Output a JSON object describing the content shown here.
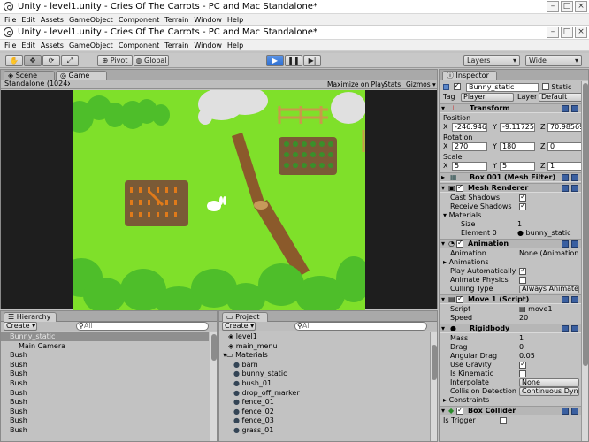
{
  "window1": {
    "title": "Unity - level1.unity - Cries Of The Carrots - PC and Mac Standalone*"
  },
  "window2": {
    "title": "Unity - level1.unity - Cries Of The Carrots - PC and Mac Standalone*"
  },
  "menu": [
    "File",
    "Edit",
    "Assets",
    "GameObject",
    "Component",
    "Terrain",
    "Window",
    "Help"
  ],
  "toolbar": {
    "pivot": "Pivot",
    "global": "Global",
    "layers": "Layers",
    "layout": "Wide"
  },
  "scene_tabs": {
    "scene": "Scene",
    "game": "Game"
  },
  "game_bar": {
    "resolution": "Standalone (1024x76",
    "maximize": "Maximize on Play",
    "stats": "Stats",
    "gizmos": "Gizmos"
  },
  "hierarchy": {
    "title": "Hierarchy",
    "create": "Create",
    "search": "All",
    "items": [
      "Bunny_static",
      "Main Camera",
      "Bush",
      "Bush",
      "Bush",
      "Bush",
      "Bush",
      "Bush",
      "Bush",
      "Bush",
      "Bush"
    ]
  },
  "project": {
    "title": "Project",
    "create": "Create",
    "search": "All",
    "items": [
      {
        "label": "level1",
        "type": "scene",
        "indent": 1
      },
      {
        "label": "main_menu",
        "type": "scene",
        "indent": 1
      },
      {
        "label": "Materials",
        "type": "folder",
        "indent": 0
      },
      {
        "label": "barn",
        "type": "material",
        "indent": 2
      },
      {
        "label": "bunny_static",
        "type": "material",
        "indent": 2
      },
      {
        "label": "bush_01",
        "type": "material",
        "indent": 2
      },
      {
        "label": "drop_off_marker",
        "type": "material",
        "indent": 2
      },
      {
        "label": "fence_01",
        "type": "material",
        "indent": 2
      },
      {
        "label": "fence_02",
        "type": "material",
        "indent": 2
      },
      {
        "label": "fence_03",
        "type": "material",
        "indent": 2
      },
      {
        "label": "grass_01",
        "type": "material",
        "indent": 2
      }
    ]
  },
  "inspector": {
    "tab": "Inspector",
    "name": "Bunny_static",
    "static": "Static",
    "tag_label": "Tag",
    "tag": "Player",
    "layer_label": "Layer",
    "layer": "Default",
    "transform": {
      "title": "Transform",
      "position": "Position",
      "rotation": "Rotation",
      "scale": "Scale",
      "pos": [
        "-246.946",
        "-9.117259",
        "70.98569"
      ],
      "rot": [
        "270",
        "180",
        "0"
      ],
      "scl": [
        "5",
        "5",
        "1"
      ]
    },
    "mesh_filter": {
      "title": "Box 001 (Mesh Filter)"
    },
    "mesh_renderer": {
      "title": "Mesh Renderer",
      "cast": "Cast Shadows",
      "receive": "Receive Shadows",
      "materials": "Materials",
      "size": "Size",
      "size_val": "1",
      "element": "Element 0",
      "element_val": "bunny_static"
    },
    "animation": {
      "title": "Animation",
      "anim": "Animation",
      "anim_val": "None (Animation",
      "animations": "Animations",
      "play_auto": "Play Automatically",
      "physics": "Animate Physics",
      "culling": "Culling Type",
      "culling_val": "Always Animate"
    },
    "script": {
      "title": "Move 1 (Script)",
      "script": "Script",
      "script_val": "move1",
      "speed": "Speed",
      "speed_val": "20"
    },
    "rigidbody": {
      "title": "Rigidbody",
      "mass": "Mass",
      "mass_val": "1",
      "drag": "Drag",
      "drag_val": "0",
      "ang": "Angular Drag",
      "ang_val": "0.05",
      "grav": "Use Gravity",
      "kin": "Is Kinematic",
      "interp": "Interpolate",
      "interp_val": "None",
      "coll": "Collision Detection",
      "coll_val": "Continuous Dyn",
      "constraints": "Constraints"
    },
    "box_collider": {
      "title": "Box Collider",
      "trigger": "Is Trigger"
    }
  },
  "axis": {
    "x": "X",
    "y": "Y",
    "z": "Z"
  },
  "colors": {
    "grass": "#7fe02a",
    "panel": "#c2c2c2",
    "play_blue": "#2e6fd1"
  }
}
